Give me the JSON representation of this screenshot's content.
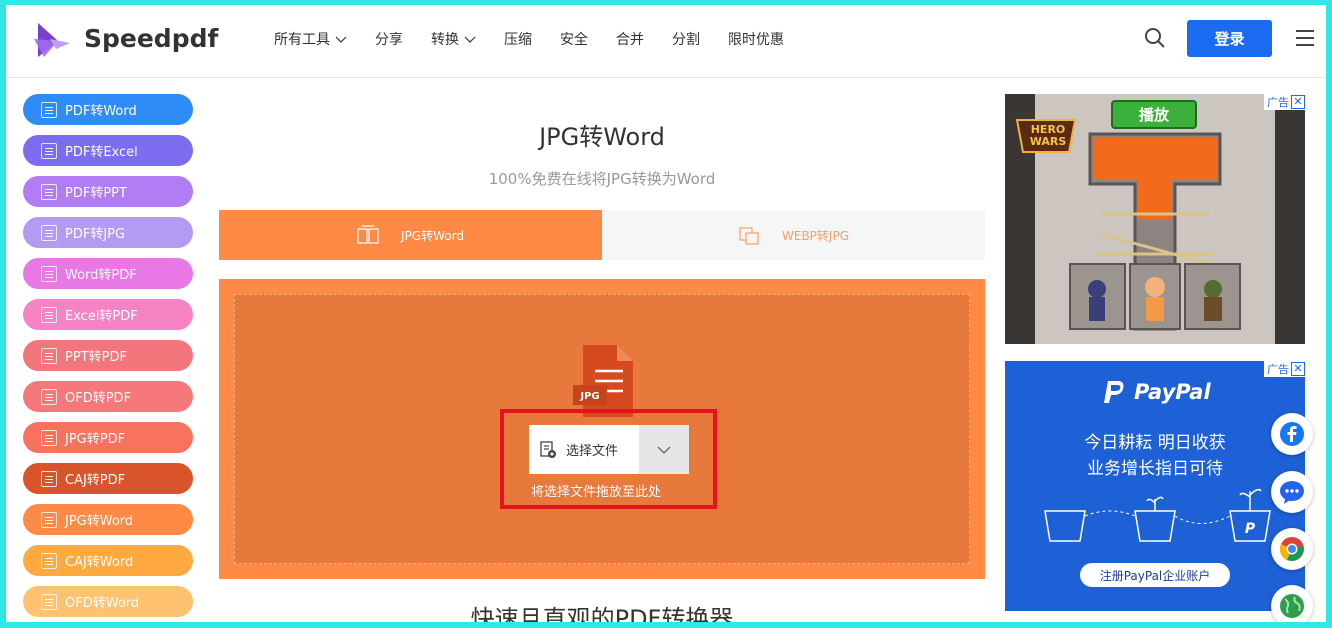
{
  "header": {
    "brand": "Speedpdf",
    "nav": [
      {
        "label": "所有工具",
        "dropdown": true
      },
      {
        "label": "分享",
        "dropdown": false
      },
      {
        "label": "转换",
        "dropdown": true
      },
      {
        "label": "压缩",
        "dropdown": false
      },
      {
        "label": "安全",
        "dropdown": false
      },
      {
        "label": "合并",
        "dropdown": false
      },
      {
        "label": "分割",
        "dropdown": false
      },
      {
        "label": "限时优惠",
        "dropdown": false
      }
    ],
    "login_label": "登录"
  },
  "sidebar": {
    "items": [
      {
        "label": "PDF转Word",
        "color": "#2f8bf5"
      },
      {
        "label": "PDF转Excel",
        "color": "#7b6cf0"
      },
      {
        "label": "PDF转PPT",
        "color": "#b27cf4"
      },
      {
        "label": "PDF转JPG",
        "color": "#b39af3"
      },
      {
        "label": "Word转PDF",
        "color": "#e778e6"
      },
      {
        "label": "Excel转PDF",
        "color": "#f782c4"
      },
      {
        "label": "PPT转PDF",
        "color": "#f4767d"
      },
      {
        "label": "OFD转PDF",
        "color": "#f6787a"
      },
      {
        "label": "JPG转PDF",
        "color": "#f9725e"
      },
      {
        "label": "CAJ转PDF",
        "color": "#d9542b"
      },
      {
        "label": "JPG转Word",
        "color": "#fe8a45"
      },
      {
        "label": "CAJ转Word",
        "color": "#feaa40"
      },
      {
        "label": "OFD转Word",
        "color": "#fec270"
      }
    ]
  },
  "main": {
    "title": "JPG转Word",
    "subtitle": "100%免费在线将JPG转换为Word",
    "tabs": [
      {
        "label": "JPG转Word",
        "active": true
      },
      {
        "label": "WEBP转JPG",
        "active": false
      }
    ],
    "file_badge": "JPG",
    "choose_file_label": "选择文件",
    "drop_hint": "将选择文件拖放至此处",
    "bottom_heading": "快速且直观的PDF转换器"
  },
  "ads": {
    "tag_label": "广告",
    "close_label": "✕",
    "game": {
      "play_label": "播放",
      "logo_text": "HERO WARS"
    },
    "paypal": {
      "logo": "PayPal",
      "line1": "今日耕耘 明日收获",
      "line2": "业务增长指日可待",
      "cta": "注册PayPal企业账户"
    }
  },
  "floating": [
    "facebook-icon",
    "chat-icon",
    "chrome-icon",
    "globe-icon"
  ]
}
